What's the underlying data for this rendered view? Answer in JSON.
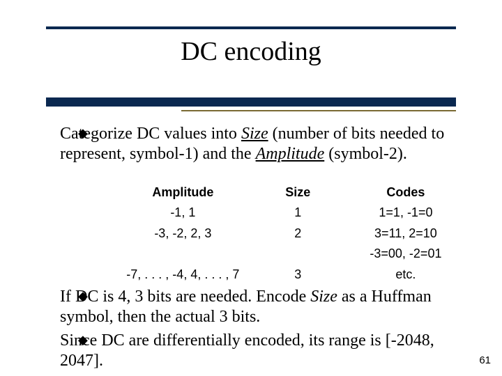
{
  "title": "DC encoding",
  "bullets": [
    {
      "pre": "Categorize DC values into ",
      "size_word": "Size",
      "mid1": " (number of bits needed to represent, symbol-1) and the ",
      "amp_word": "Amplitude",
      "mid2": " (symbol-2)."
    },
    {
      "pre": "If DC is 4, 3 bits are needed.  Encode ",
      "size_word": "Size",
      "post": " as a Huffman symbol, then the actual 3 bits."
    },
    {
      "text": "Since DC are differentially encoded, its range is [-2048, 2047]."
    }
  ],
  "table": {
    "headers": {
      "amplitude": "Amplitude",
      "size": "Size",
      "codes": "Codes"
    },
    "rows": [
      {
        "amplitude": "-1, 1",
        "size": "1",
        "codes": "1=1, -1=0"
      },
      {
        "amplitude": "-3, -2, 2, 3",
        "size": "2",
        "codes": "3=11, 2=10"
      },
      {
        "amplitude": "",
        "size": "",
        "codes": "-3=00, -2=01"
      },
      {
        "amplitude": "-7, . . . , -4, 4, . . . , 7",
        "size": "3",
        "codes": "etc."
      }
    ]
  },
  "page_number": "61"
}
